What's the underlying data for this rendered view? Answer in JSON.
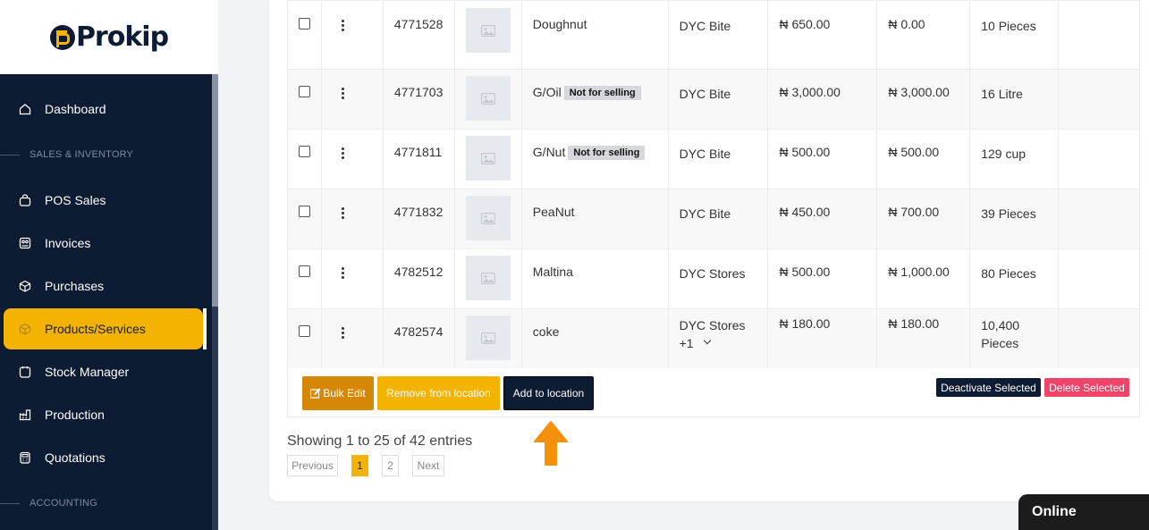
{
  "brand": {
    "name": "Prokip"
  },
  "sidebar": {
    "items": [
      {
        "label": "Dashboard"
      },
      {
        "label": "POS Sales"
      },
      {
        "label": "Invoices"
      },
      {
        "label": "Purchases"
      },
      {
        "label": "Products/Services"
      },
      {
        "label": "Stock Manager"
      },
      {
        "label": "Production"
      },
      {
        "label": "Quotations"
      }
    ],
    "sections": [
      {
        "label": "SALES & INVENTORY"
      },
      {
        "label": "ACCOUNTING"
      }
    ],
    "active": "Products/Services"
  },
  "table": {
    "rows": [
      {
        "sku": "4771528",
        "name": "Doughnut",
        "tag": "",
        "location": "DYC Bite",
        "location_extra": "",
        "purchase_price": "₦ 650.00",
        "selling_price": "₦ 0.00",
        "stock": "10 Pieces"
      },
      {
        "sku": "4771703",
        "name": "G/Oil",
        "tag": "Not for selling",
        "location": "DYC Bite",
        "location_extra": "",
        "purchase_price": "₦ 3,000.00",
        "selling_price": "₦ 3,000.00",
        "stock": "16 Litre"
      },
      {
        "sku": "4771811",
        "name": "G/Nut",
        "tag": "Not for selling",
        "location": "DYC Bite",
        "location_extra": "",
        "purchase_price": "₦ 500.00",
        "selling_price": "₦ 500.00",
        "stock": "129 cup"
      },
      {
        "sku": "4771832",
        "name": "PeaNut",
        "tag": "",
        "location": "DYC Bite",
        "location_extra": "",
        "purchase_price": "₦ 450.00",
        "selling_price": "₦ 700.00",
        "stock": "39 Pieces"
      },
      {
        "sku": "4782512",
        "name": "Maltina",
        "tag": "",
        "location": "DYC Stores",
        "location_extra": "",
        "purchase_price": "₦ 500.00",
        "selling_price": "₦ 1,000.00",
        "stock": "80 Pieces"
      },
      {
        "sku": "4782574",
        "name": "coke",
        "tag": "",
        "location": "DYC Stores",
        "location_extra": "+1",
        "purchase_price": "₦ 180.00",
        "selling_price": "₦ 180.00",
        "stock": "10,400 Pieces"
      }
    ]
  },
  "actions": {
    "bulk_edit": "Bulk Edit",
    "remove_from_location": "Remove from location",
    "add_to_location": "Add to location",
    "deactivate_selected": "Deactivate Selected",
    "delete_selected": "Delete Selected"
  },
  "pagination": {
    "summary": "Showing 1 to 25 of 42 entries",
    "previous": "Previous",
    "pages": [
      "1",
      "2"
    ],
    "current": "1",
    "next": "Next"
  },
  "chat": {
    "status": "Online"
  },
  "colors": {
    "accent": "#f5b301",
    "navy": "#0d1b33",
    "danger": "#f1446b",
    "arrow": "#f5900a"
  }
}
